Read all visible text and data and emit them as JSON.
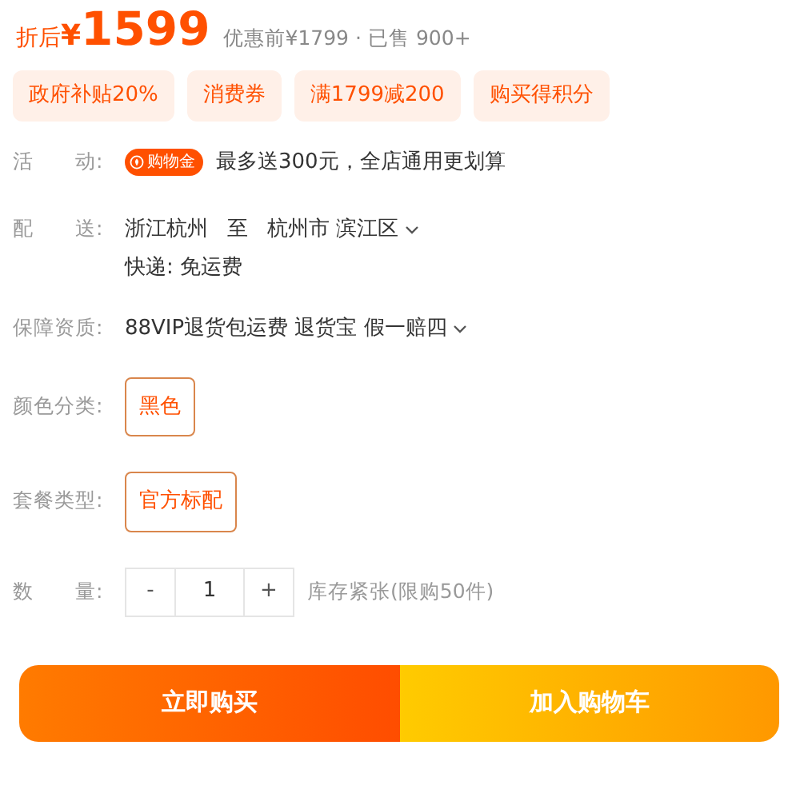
{
  "price": {
    "prefix": "折后",
    "currency": "¥",
    "amount": "1599",
    "original": "优惠前¥1799",
    "separator": "·",
    "sold": "已售 900+"
  },
  "tags": [
    "政府补贴20%",
    "消费券",
    "满1799减200",
    "购买得积分"
  ],
  "rows": [
    {
      "kind": "promo",
      "label": "活　　动:",
      "badge": "购物金",
      "text": "最多送300元，全店通用更划算"
    },
    {
      "kind": "delivery",
      "label": "配　　送:",
      "from": "浙江杭州",
      "to_word": "至",
      "to": "杭州市 滨江区",
      "shipping": "快递: 免运费"
    },
    {
      "kind": "guarantee",
      "label": "保障资质:",
      "text": "88VIP退货包运费 退货宝 假一赔四"
    },
    {
      "kind": "options",
      "label": "颜色分类:",
      "options": [
        {
          "label": "黑色",
          "selected": true
        }
      ]
    },
    {
      "kind": "options",
      "label": "套餐类型:",
      "options": [
        {
          "label": "官方标配",
          "selected": true
        }
      ]
    },
    {
      "kind": "quantity",
      "label": "数　　量:",
      "minus": "-",
      "value": "1",
      "plus": "+",
      "note": "库存紧张(限购50件)"
    }
  ],
  "buttons": [
    {
      "kind": "buy",
      "label": "立即购买"
    },
    {
      "kind": "cart",
      "label": "加入购物车"
    }
  ]
}
